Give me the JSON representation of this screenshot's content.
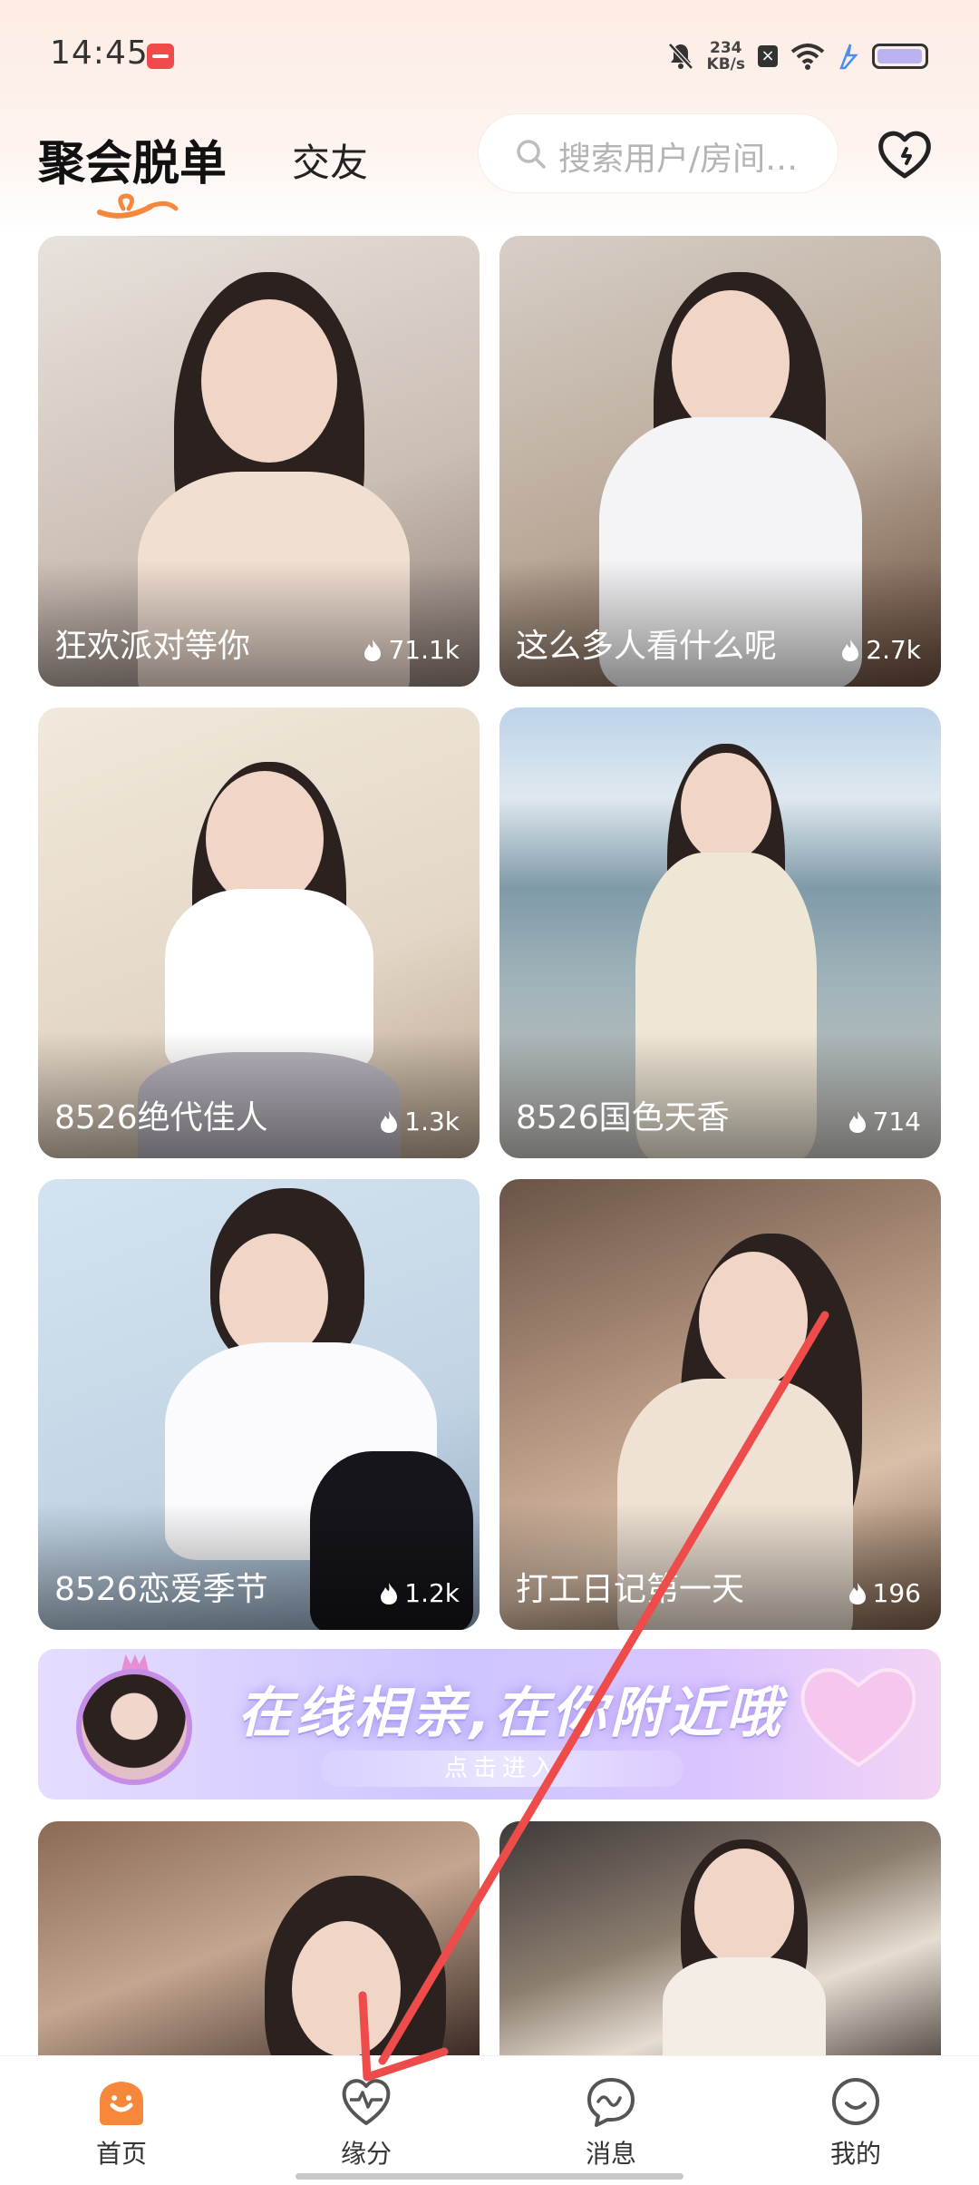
{
  "status_bar": {
    "time": "14:45",
    "net_speed_value": "234",
    "net_speed_unit": "KB/s",
    "x_badge": "×",
    "icons": [
      "app-notification-icon",
      "mute-bell-icon",
      "close-box-icon",
      "wifi-icon",
      "charging-bolt-icon",
      "battery-icon"
    ]
  },
  "header": {
    "tab_active": "聚会脱单",
    "tab_inactive": "交友",
    "search_placeholder": "搜索用户/房间…",
    "heart_icon": "heart-outline-icon"
  },
  "cards": [
    {
      "title": "狂欢派对等你",
      "count": "71.1k"
    },
    {
      "title": "这么多人看什么呢",
      "count": "2.7k"
    },
    {
      "title": "8526绝代佳人",
      "count": "1.3k"
    },
    {
      "title": "8526国色天香",
      "count": "714"
    },
    {
      "title": "8526恋爱季节",
      "count": "1.2k"
    },
    {
      "title": "打工日记第一天",
      "count": "196"
    },
    {
      "title": "",
      "count": ""
    },
    {
      "title": "",
      "count": ""
    }
  ],
  "banner": {
    "headline": "在线相亲,在你附近哦",
    "button": "点击进入"
  },
  "bottom_nav": [
    {
      "label": "首页",
      "icon": "home-icon",
      "active": true
    },
    {
      "label": "缘分",
      "icon": "heartbeat-icon",
      "active": false
    },
    {
      "label": "消息",
      "icon": "message-wave-icon",
      "active": false
    },
    {
      "label": "我的",
      "icon": "smile-face-icon",
      "active": false
    }
  ],
  "colors": {
    "accent_orange": "#f7873a",
    "annotation_arrow": "#ee4b4b",
    "banner_purple": "#cfc6ff"
  }
}
